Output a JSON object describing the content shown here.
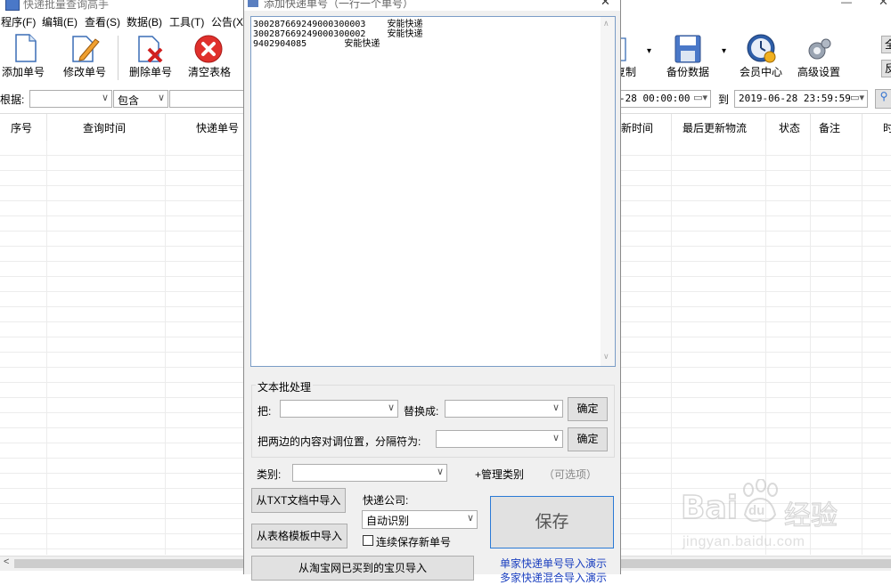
{
  "main_window": {
    "title": "快递批量查询高手",
    "menu": [
      "程序(F)",
      "编辑(E)",
      "查看(S)",
      "数据(B)",
      "工具(T)",
      "公告(X"
    ],
    "toolbar_left": [
      "添加单号",
      "修改单号",
      "删除单号",
      "清空表格"
    ],
    "toolbar_right": [
      "复制",
      "备份数据",
      "会员中心",
      "高级设置"
    ],
    "right_edge_buttons": [
      "全",
      "反"
    ],
    "filter": {
      "label": "根据:",
      "field_value": "",
      "match_value": "包含",
      "date_from": "-28 00:00:00",
      "to_label": "到",
      "date_to": "2019-06-28 23:59:59"
    },
    "columns_left": [
      "序号",
      "查询时间",
      "快递单号"
    ],
    "columns_right": [
      "新时间",
      "最后更新物流",
      "状态",
      "备注",
      "时"
    ]
  },
  "dialog": {
    "title": "添加快递单号（一行一个单号）",
    "text_lines": [
      "300287669249000300003    安能快递",
      "300287669249000300002    安能快递",
      "9402904085       安能快递"
    ],
    "batch_group_title": "文本批处理",
    "replace_from_label": "把:",
    "replace_to_label": "替换成:",
    "confirm_label": "确定",
    "swap_label": "把两边的内容对调位置，分隔符为:",
    "category_label": "类别:",
    "manage_category": "+管理类别",
    "optional_note": "（可选项）",
    "import_txt": "从TXT文档中导入",
    "import_table": "从表格模板中导入",
    "import_taobao": "从淘宝网已买到的宝贝导入",
    "courier_label": "快递公司:",
    "courier_value": "自动识别",
    "continue_save": "连续保存新单号",
    "continue_checked": false,
    "save_label": "保存",
    "demo_link_1": "单家快递单号导入演示",
    "demo_link_2": "多家快递混合导入演示"
  },
  "watermark": {
    "brand": "Bai",
    "brand2": "du",
    "cn": "经验",
    "url": "jingyan.baidu.com"
  }
}
